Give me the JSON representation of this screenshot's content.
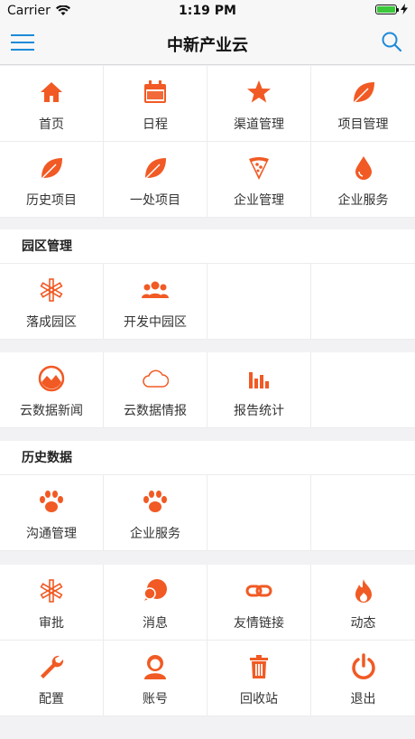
{
  "status_bar": {
    "carrier": "Carrier",
    "time": "1:19 PM"
  },
  "nav": {
    "title": "中新产业云"
  },
  "colors": {
    "accent": "#f15a24",
    "nav_icon": "#1e8bd8"
  },
  "grid_main": {
    "items": [
      {
        "label": "首页",
        "icon": "home-icon"
      },
      {
        "label": "日程",
        "icon": "calendar-icon"
      },
      {
        "label": "渠道管理",
        "icon": "star-icon"
      },
      {
        "label": "项目管理",
        "icon": "leaf-icon"
      },
      {
        "label": "历史项目",
        "icon": "leaf-icon"
      },
      {
        "label": "一处项目",
        "icon": "leaf-icon"
      },
      {
        "label": "企业管理",
        "icon": "pizza-icon"
      },
      {
        "label": "企业服务",
        "icon": "drop-icon"
      }
    ]
  },
  "park": {
    "header": "园区管理",
    "items": [
      {
        "label": "落成园区",
        "icon": "asterisk-icon"
      },
      {
        "label": "开发中园区",
        "icon": "users-icon"
      }
    ]
  },
  "cloud": {
    "items": [
      {
        "label": "云数据新闻",
        "icon": "image-circle-icon"
      },
      {
        "label": "云数据情报",
        "icon": "cloud-icon"
      },
      {
        "label": "报告统计",
        "icon": "bar-chart-icon"
      }
    ]
  },
  "history": {
    "header": "历史数据",
    "items": [
      {
        "label": "沟通管理",
        "icon": "paw-icon"
      },
      {
        "label": "企业服务",
        "icon": "paw-icon"
      }
    ]
  },
  "system": {
    "items": [
      {
        "label": "审批",
        "icon": "asterisk-icon"
      },
      {
        "label": "消息",
        "icon": "chat-icon"
      },
      {
        "label": "友情链接",
        "icon": "link-icon"
      },
      {
        "label": "动态",
        "icon": "fire-icon"
      },
      {
        "label": "配置",
        "icon": "wrench-icon"
      },
      {
        "label": "账号",
        "icon": "user-icon"
      },
      {
        "label": "回收站",
        "icon": "trash-icon"
      },
      {
        "label": "退出",
        "icon": "power-icon"
      }
    ]
  }
}
